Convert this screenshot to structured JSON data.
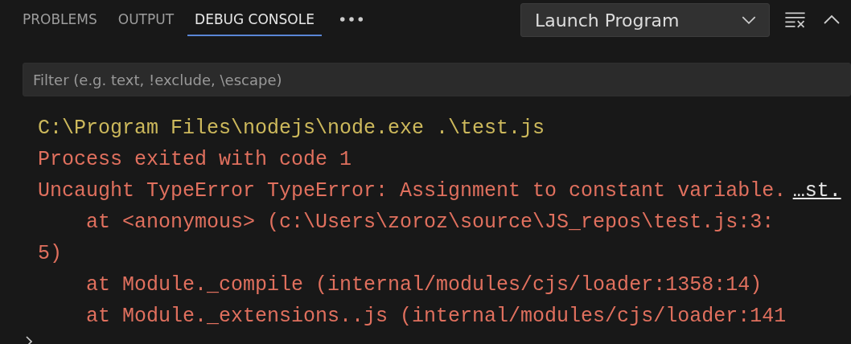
{
  "tabs": [
    {
      "label": "PROBLEMS",
      "selected": false
    },
    {
      "label": "OUTPUT",
      "selected": false
    },
    {
      "label": "DEBUG CONSOLE",
      "selected": true
    }
  ],
  "launch_config": {
    "value": "Launch Program"
  },
  "filter": {
    "placeholder": "Filter (e.g. text, !exclude, \\escape)"
  },
  "console_lines": [
    {
      "kind": "command",
      "text": "C:\\Program Files\\nodejs\\node.exe .\\test.js"
    },
    {
      "kind": "error",
      "text": "Process exited with code 1"
    },
    {
      "kind": "error",
      "text": "Uncaught TypeError TypeError: Assignment to constant variable. ",
      "source_link": "…st."
    },
    {
      "kind": "error",
      "text": "    at <anonymous> (c:\\Users\\zoroz\\source\\JS_repos\\test.js:3:5)"
    },
    {
      "kind": "error",
      "text": "    at Module._compile (internal/modules/cjs/loader:1358:14)"
    },
    {
      "kind": "error",
      "text": "    at Module._extensions..js (internal/modules/cjs/loader:141"
    },
    {
      "kind": "group",
      "expandable": true
    }
  ]
}
